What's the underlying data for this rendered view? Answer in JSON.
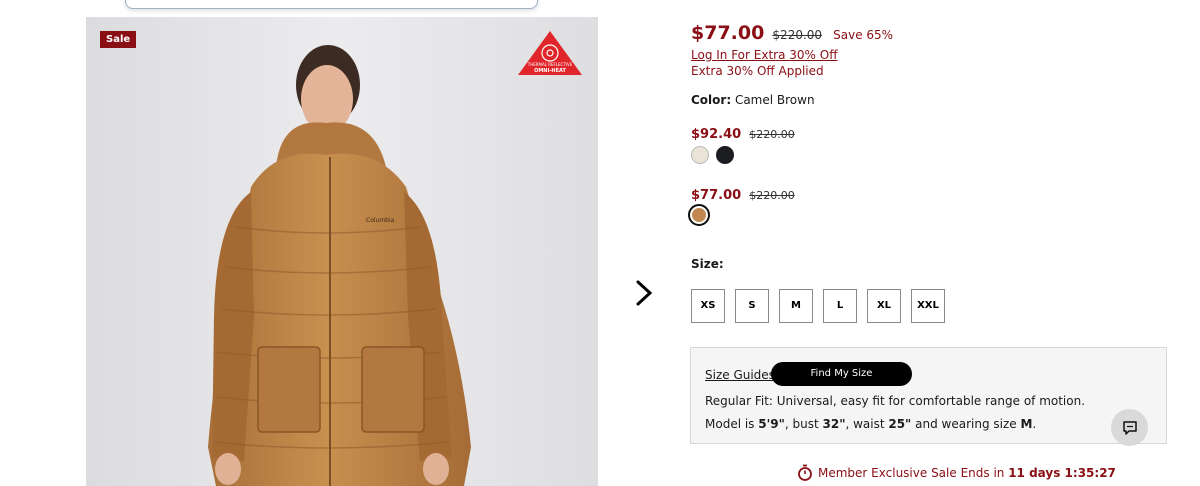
{
  "gallery": {
    "sale_badge": "Sale",
    "omni_badge_line1": "THERMAL REFLECTIVE",
    "omni_badge_line2": "OMNI-HEAT",
    "jacket_logo": "Columbia"
  },
  "pricing": {
    "current": "$77.00",
    "original": "$220.00",
    "save": "Save 65%",
    "login_link": "Log In For Extra 30% Off",
    "extra_applied": "Extra 30% Off Applied"
  },
  "color": {
    "label": "Color:",
    "value": "Camel Brown"
  },
  "variant_groups": [
    {
      "sale": "$92.40",
      "original": "$220.00",
      "swatches": [
        {
          "color": "#ece3d8",
          "selected": false
        },
        {
          "color": "#1c1d20",
          "selected": false
        }
      ]
    },
    {
      "sale": "$77.00",
      "original": "$220.00",
      "swatches": [
        {
          "color": "#c08850",
          "selected": true
        }
      ]
    }
  ],
  "size": {
    "label": "Size:",
    "options": [
      "XS",
      "S",
      "M",
      "L",
      "XL",
      "XXL"
    ]
  },
  "fit": {
    "size_guides": "Size Guides",
    "find_my_size": "Find My Size",
    "regular_fit": "Regular Fit: Universal, easy fit for comfortable range of motion.",
    "model_prefix": "Model is ",
    "model_height": "5'9\"",
    "model_bust_prefix": ", bust ",
    "model_bust": "32\"",
    "model_waist_prefix": ", waist ",
    "model_waist": "25\"",
    "model_size_prefix": " and wearing size ",
    "model_size": "M",
    "model_suffix": "."
  },
  "timer": {
    "label": "Member Exclusive Sale Ends in ",
    "value": "11 days 1:35:27"
  },
  "colors": {
    "sale_red": "#8a0f15",
    "jacket": "#c08850"
  }
}
